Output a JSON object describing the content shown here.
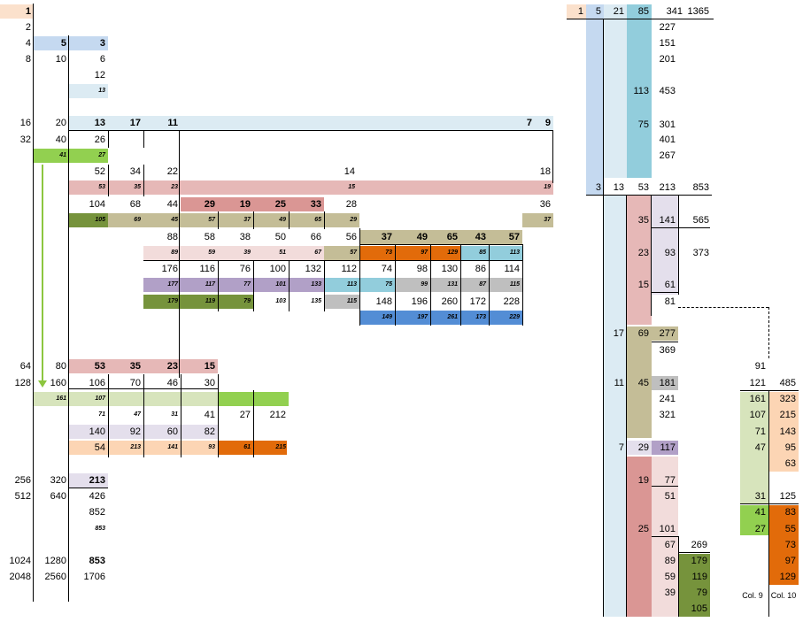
{
  "colors": {
    "peach": "#fbe1cc",
    "lightblue": "#c5d9f0",
    "paleblue": "#dcebf3",
    "cyan": "#92cddc",
    "pink": "#e6b8b7",
    "rose": "#da9694",
    "palepink": "#f2dcdb",
    "tan": "#c4bd97",
    "olive": "#76933c",
    "lime": "#92d050",
    "palelime": "#d7e4bc",
    "lavender": "#e4dfec",
    "purple": "#b1a0c7",
    "orange": "#e26b0a",
    "lightorange": "#fcd5b4",
    "gray": "#bfbfbf",
    "blue": "#538dd5"
  },
  "column_labels": [
    "Col. 9",
    "Col. 10"
  ],
  "left_cells": [
    {
      "t": "1",
      "b": 1
    },
    {
      "t": "2"
    },
    {
      "t": "4"
    },
    {
      "t": "5",
      "b": 1
    },
    {
      "t": "3",
      "b": 1
    },
    {
      "t": "8"
    },
    {
      "t": "10"
    },
    {
      "t": "6"
    },
    {
      "t": "12"
    },
    {
      "t": "13",
      "s": 1
    },
    {
      "t": "16"
    },
    {
      "t": "20"
    },
    {
      "t": "13",
      "b": 1
    },
    {
      "t": "17",
      "b": 1
    },
    {
      "t": "11",
      "b": 1
    },
    {
      "t": "7",
      "b": 1
    },
    {
      "t": "9",
      "b": 1
    },
    {
      "t": "32"
    },
    {
      "t": "40"
    },
    {
      "t": "26"
    },
    {
      "t": "41",
      "s": 1
    },
    {
      "t": "27",
      "s": 1
    },
    {
      "t": "52"
    },
    {
      "t": "34"
    },
    {
      "t": "22"
    },
    {
      "t": "14"
    },
    {
      "t": "18"
    },
    {
      "t": "53",
      "s": 1
    },
    {
      "t": "35",
      "s": 1
    },
    {
      "t": "23",
      "s": 1
    },
    {
      "t": "15",
      "s": 1
    },
    {
      "t": "19",
      "s": 1
    },
    {
      "t": "104"
    },
    {
      "t": "68"
    },
    {
      "t": "44"
    },
    {
      "t": "29",
      "b": 1
    },
    {
      "t": "19",
      "b": 1
    },
    {
      "t": "25",
      "b": 1
    },
    {
      "t": "33",
      "b": 1
    },
    {
      "t": "28"
    },
    {
      "t": "36"
    },
    {
      "t": "105",
      "s": 1
    },
    {
      "t": "69",
      "s": 1
    },
    {
      "t": "45",
      "s": 1
    },
    {
      "t": "57",
      "s": 1
    },
    {
      "t": "37",
      "s": 1
    },
    {
      "t": "49",
      "s": 1
    },
    {
      "t": "65",
      "s": 1
    },
    {
      "t": "29",
      "s": 1
    },
    {
      "t": "37",
      "s": 1
    },
    {
      "t": "88"
    },
    {
      "t": "58"
    },
    {
      "t": "38"
    },
    {
      "t": "50"
    },
    {
      "t": "66"
    },
    {
      "t": "56"
    },
    {
      "t": "37",
      "b": 1
    },
    {
      "t": "49",
      "b": 1
    },
    {
      "t": "65",
      "b": 1
    },
    {
      "t": "43",
      "b": 1
    },
    {
      "t": "57",
      "b": 1
    },
    {
      "t": "89",
      "s": 1
    },
    {
      "t": "59",
      "s": 1
    },
    {
      "t": "39",
      "s": 1
    },
    {
      "t": "51",
      "s": 1
    },
    {
      "t": "67",
      "s": 1
    },
    {
      "t": "57",
      "s": 1
    },
    {
      "t": "73",
      "s": 1
    },
    {
      "t": "97",
      "s": 1
    },
    {
      "t": "129",
      "s": 1
    },
    {
      "t": "85",
      "s": 1
    },
    {
      "t": "113",
      "s": 1
    },
    {
      "t": "176"
    },
    {
      "t": "116"
    },
    {
      "t": "76"
    },
    {
      "t": "100"
    },
    {
      "t": "132"
    },
    {
      "t": "112"
    },
    {
      "t": "74"
    },
    {
      "t": "98"
    },
    {
      "t": "130"
    },
    {
      "t": "86"
    },
    {
      "t": "114"
    },
    {
      "t": "177",
      "s": 1
    },
    {
      "t": "117",
      "s": 1
    },
    {
      "t": "77",
      "s": 1
    },
    {
      "t": "101",
      "s": 1
    },
    {
      "t": "133",
      "s": 1
    },
    {
      "t": "113",
      "s": 1
    },
    {
      "t": "75",
      "s": 1
    },
    {
      "t": "99",
      "s": 1
    },
    {
      "t": "131",
      "s": 1
    },
    {
      "t": "87",
      "s": 1
    },
    {
      "t": "115",
      "s": 1
    },
    {
      "t": "179",
      "s": 1
    },
    {
      "t": "119",
      "s": 1
    },
    {
      "t": "79",
      "s": 1
    },
    {
      "t": "103",
      "s": 1
    },
    {
      "t": "135",
      "s": 1
    },
    {
      "t": "115",
      "s": 1
    },
    {
      "t": "148"
    },
    {
      "t": "196"
    },
    {
      "t": "260"
    },
    {
      "t": "172"
    },
    {
      "t": "228"
    },
    {
      "t": "149",
      "s": 1
    },
    {
      "t": "197",
      "s": 1
    },
    {
      "t": "261",
      "s": 1
    },
    {
      "t": "173",
      "s": 1
    },
    {
      "t": "229",
      "s": 1
    },
    {
      "t": "64"
    },
    {
      "t": "80"
    },
    {
      "t": "53",
      "b": 1
    },
    {
      "t": "35",
      "b": 1
    },
    {
      "t": "23",
      "b": 1
    },
    {
      "t": "15",
      "b": 1
    },
    {
      "t": "128"
    },
    {
      "t": "160"
    },
    {
      "t": "106"
    },
    {
      "t": "70"
    },
    {
      "t": "46"
    },
    {
      "t": "30"
    },
    {
      "t": "161",
      "s": 1
    },
    {
      "t": "107",
      "s": 1
    },
    {
      "t": "71",
      "s": 1
    },
    {
      "t": "47",
      "s": 1
    },
    {
      "t": "31",
      "s": 1
    },
    {
      "t": "41"
    },
    {
      "t": "27"
    },
    {
      "t": "212"
    },
    {
      "t": "140"
    },
    {
      "t": "92"
    },
    {
      "t": "60"
    },
    {
      "t": "82"
    },
    {
      "t": "54"
    },
    {
      "t": "213",
      "s": 1
    },
    {
      "t": "141",
      "s": 1
    },
    {
      "t": "93",
      "s": 1
    },
    {
      "t": "61",
      "s": 1
    },
    {
      "t": "215",
      "s": 1
    },
    {
      "t": "143",
      "s": 1
    },
    {
      "t": "95",
      "s": 1
    },
    {
      "t": "63",
      "s": 1
    },
    {
      "t": "83",
      "s": 1
    },
    {
      "t": "55",
      "s": 1
    },
    {
      "t": "256"
    },
    {
      "t": "320"
    },
    {
      "t": "213",
      "b": 1
    },
    {
      "t": "512"
    },
    {
      "t": "640"
    },
    {
      "t": "426"
    },
    {
      "t": "852"
    },
    {
      "t": "853",
      "s": 1
    },
    {
      "t": "1024"
    },
    {
      "t": "1280"
    },
    {
      "t": "853",
      "b": 1
    },
    {
      "t": "2048"
    },
    {
      "t": "2560"
    },
    {
      "t": "1706"
    }
  ],
  "right_cells": [
    {
      "t": "1"
    },
    {
      "t": "5"
    },
    {
      "t": "21"
    },
    {
      "t": "85"
    },
    {
      "t": "341"
    },
    {
      "t": "1365"
    },
    {
      "t": "227"
    },
    {
      "t": "151"
    },
    {
      "t": "201"
    },
    {
      "t": "113"
    },
    {
      "t": "453"
    },
    {
      "t": "75"
    },
    {
      "t": "301"
    },
    {
      "t": "401"
    },
    {
      "t": "267"
    },
    {
      "t": "3"
    },
    {
      "t": "13"
    },
    {
      "t": "53"
    },
    {
      "t": "213"
    },
    {
      "t": "853"
    },
    {
      "t": "35"
    },
    {
      "t": "141"
    },
    {
      "t": "565"
    },
    {
      "t": "23"
    },
    {
      "t": "93"
    },
    {
      "t": "373"
    },
    {
      "t": "15"
    },
    {
      "t": "61"
    },
    {
      "t": "81"
    },
    {
      "t": "17"
    },
    {
      "t": "69"
    },
    {
      "t": "277"
    },
    {
      "t": "369"
    },
    {
      "t": "91"
    },
    {
      "t": "11"
    },
    {
      "t": "45"
    },
    {
      "t": "181"
    },
    {
      "t": "121"
    },
    {
      "t": "485"
    },
    {
      "t": "241"
    },
    {
      "t": "161"
    },
    {
      "t": "323"
    },
    {
      "t": "321"
    },
    {
      "t": "107"
    },
    {
      "t": "215"
    },
    {
      "t": "71"
    },
    {
      "t": "143"
    },
    {
      "t": "7"
    },
    {
      "t": "29"
    },
    {
      "t": "117"
    },
    {
      "t": "47"
    },
    {
      "t": "95"
    },
    {
      "t": "63"
    },
    {
      "t": "19"
    },
    {
      "t": "77"
    },
    {
      "t": "51"
    },
    {
      "t": "31"
    },
    {
      "t": "125"
    },
    {
      "t": "41"
    },
    {
      "t": "83"
    },
    {
      "t": "25"
    },
    {
      "t": "101"
    },
    {
      "t": "27"
    },
    {
      "t": "55"
    },
    {
      "t": "67"
    },
    {
      "t": "269"
    },
    {
      "t": "73"
    },
    {
      "t": "89"
    },
    {
      "t": "179"
    },
    {
      "t": "97"
    },
    {
      "t": "59"
    },
    {
      "t": "119"
    },
    {
      "t": "129"
    },
    {
      "t": "39"
    },
    {
      "t": "79"
    },
    {
      "t": "105"
    }
  ]
}
